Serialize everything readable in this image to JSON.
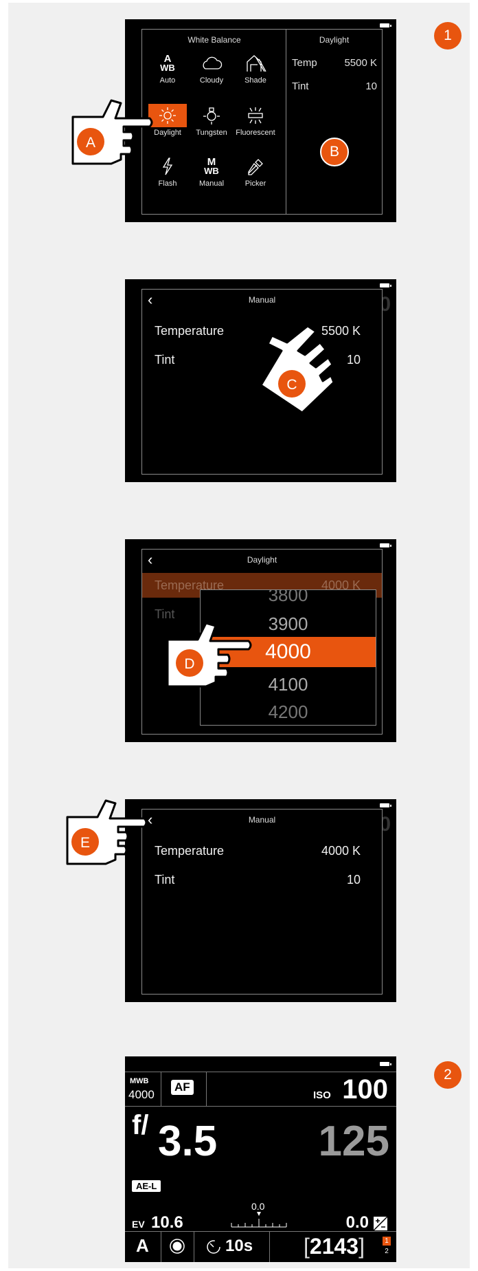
{
  "steps": {
    "one": "1",
    "two": "2"
  },
  "hands": {
    "a": "A",
    "b": "B",
    "c": "C",
    "d": "D",
    "e": "E"
  },
  "colors": {
    "accent": "#e8550f",
    "background": "#f0f0f0",
    "screen": "#000000"
  },
  "screen1": {
    "left_title": "White Balance",
    "items": [
      {
        "label": "Auto",
        "icon": "awb-icon"
      },
      {
        "label": "Cloudy",
        "icon": "cloud-icon"
      },
      {
        "label": "Shade",
        "icon": "shade-house-icon"
      },
      {
        "label": "Daylight",
        "icon": "sun-icon",
        "selected": true
      },
      {
        "label": "Tungsten",
        "icon": "bulb-icon"
      },
      {
        "label": "Fluorescent",
        "icon": "fluorescent-icon"
      },
      {
        "label": "Flash",
        "icon": "flash-icon"
      },
      {
        "label": "Manual",
        "icon": "mwb-icon"
      },
      {
        "label": "Picker",
        "icon": "eyedropper-icon"
      }
    ],
    "right_title": "Daylight",
    "temp_label": "Temp",
    "temp_value": "5500 K",
    "tint_label": "Tint",
    "tint_value": "10",
    "awb_top": "A",
    "awb_bottom": "WB",
    "mwb_top": "M",
    "mwb_bottom": "WB"
  },
  "screen2": {
    "title": "Manual",
    "temperature_label": "Temperature",
    "temperature_value": "5500 K",
    "tint_label": "Tint",
    "tint_value": "10"
  },
  "screen3": {
    "title": "Daylight",
    "temperature_label": "Temperature",
    "temperature_value": "4000 K",
    "tint_label": "Tint",
    "picker": [
      "3800",
      "3900",
      "4000",
      "4100",
      "4200"
    ],
    "picker_selected": "4000"
  },
  "screen4": {
    "title": "Manual",
    "temperature_label": "Temperature",
    "temperature_value": "4000 K",
    "tint_label": "Tint",
    "tint_value": "10"
  },
  "status": {
    "wb_mode": "MWB",
    "wb_value": "4000",
    "af": "AF",
    "iso_label": "ISO",
    "iso_value": "100",
    "aperture_prefix": "f/",
    "aperture_value": "3.5",
    "shutter": "125",
    "ae_lock": "AE-L",
    "ev_label": "EV",
    "ev_value": "10.6",
    "meter_value": "0.0",
    "exp_comp": "0.0",
    "mode": "A",
    "timer": "10s",
    "shots": "2143",
    "slot_top": "1",
    "slot_bottom": "2"
  }
}
